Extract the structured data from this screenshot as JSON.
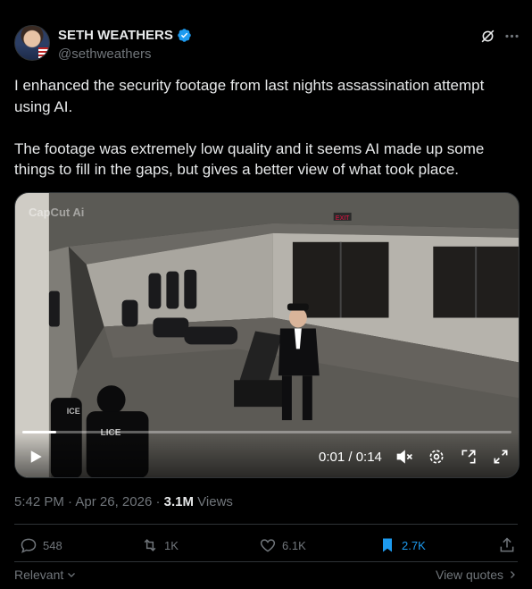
{
  "author": {
    "display_name": "SETH WEATHERS",
    "handle": "@sethweathers",
    "verified": true
  },
  "tweet": {
    "text": "I enhanced the security footage from last nights assassination attempt using AI.\n\nThe footage was extremely low quality and it seems AI made up some things to fill in the gaps, but gives a better view of what took place."
  },
  "media": {
    "watermark": "CapCut Ai",
    "exit_sign": "EXIT",
    "vest_text_left": "ICE",
    "vest_text_right": "LICE",
    "time": "0:01 / 0:14",
    "progress": 0.07
  },
  "meta": {
    "time": "5:42 PM",
    "separator": "·",
    "date": "Apr 26, 2026",
    "separator2": "·",
    "views_count": "3.1M",
    "views_label": "Views"
  },
  "actions": {
    "replies": "548",
    "reposts": "1K",
    "likes": "6.1K",
    "bookmarks": "2.7K"
  },
  "footer": {
    "sort_label": "Relevant",
    "view_quotes_label": "View quotes"
  },
  "colors": {
    "background": "#000000",
    "text": "#e7e9ea",
    "secondary": "#71767b",
    "accent": "#1d9bf0",
    "divider": "#2f3336"
  }
}
